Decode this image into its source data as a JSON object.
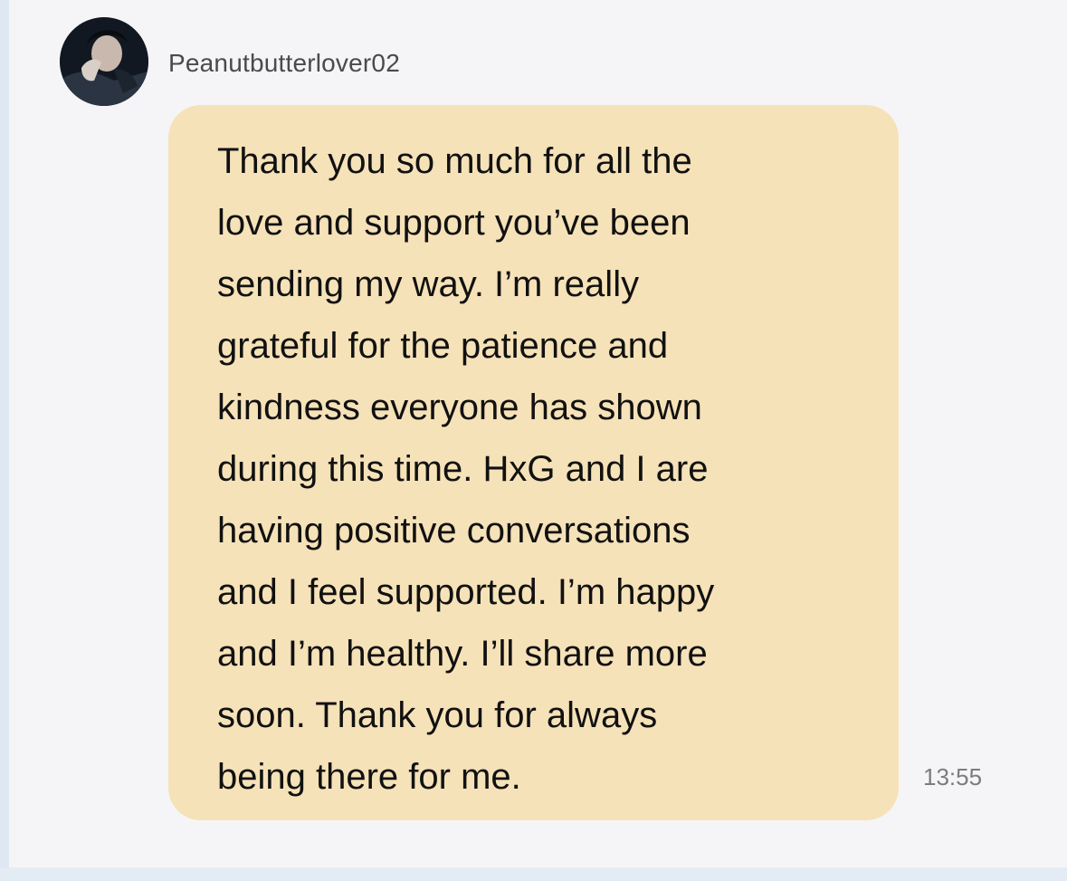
{
  "chat": {
    "sender": {
      "username": "Peanutbutterlover02",
      "avatar_icon": "profile-photo-avatar"
    },
    "message": {
      "lines": [
        "Thank you so much for all the",
        "love and support you’ve been",
        "sending my way. I’m really",
        "grateful for the patience and",
        "kindness everyone has shown",
        "during this time.  HxG and I are",
        "having positive conversations",
        "and I feel supported. I’m happy",
        "and I’m healthy.  I’ll share more",
        "soon. Thank you for always",
        "being there for me."
      ],
      "timestamp": "13:55",
      "bubble_color": "#f6e2b8"
    }
  },
  "colors": {
    "background": "#f5f5f7",
    "text": "#111111",
    "username": "#4a4a4a",
    "timestamp": "#7c7c7c"
  }
}
